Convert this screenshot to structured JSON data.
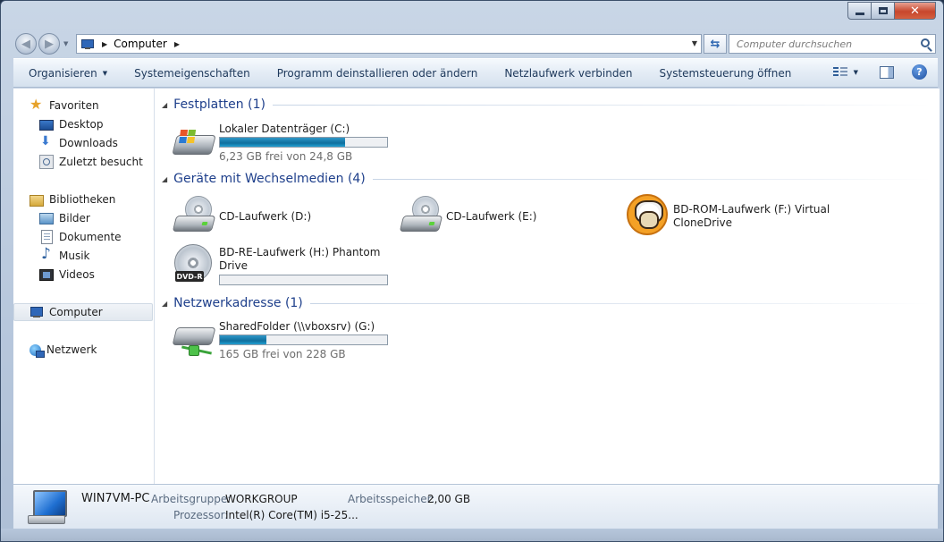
{
  "address": {
    "path": [
      "Computer"
    ],
    "search_placeholder": "Computer durchsuchen"
  },
  "toolbar": {
    "organize": "Organisieren",
    "items": [
      "Systemeigenschaften",
      "Programm deinstallieren oder ändern",
      "Netzlaufwerk verbinden",
      "Systemsteuerung öffnen"
    ],
    "help": "?"
  },
  "sidebar": {
    "favorites": "Favoriten",
    "favorites_items": [
      "Desktop",
      "Downloads",
      "Zuletzt besucht"
    ],
    "libraries": "Bibliotheken",
    "libraries_items": [
      "Bilder",
      "Dokumente",
      "Musik",
      "Videos"
    ],
    "computer": "Computer",
    "network": "Netzwerk"
  },
  "groups": [
    {
      "title": "Festplatten (1)"
    },
    {
      "title": "Geräte mit Wechselmedien (4)"
    },
    {
      "title": "Netzwerkadresse (1)"
    }
  ],
  "drives": {
    "c": {
      "name": "Lokaler Datenträger (C:)",
      "free": "6,23 GB frei von 24,8 GB",
      "used_fraction": 0.75
    },
    "d": {
      "name": "CD-Laufwerk (D:)"
    },
    "e": {
      "name": "CD-Laufwerk (E:)"
    },
    "f": {
      "name_line1": "BD-ROM-Laufwerk (F:) Virtual",
      "name_line2": "CloneDrive"
    },
    "h": {
      "name_line1": "BD-RE-Laufwerk (H:) Phantom",
      "name_line2": "Drive",
      "used_fraction": 0.0,
      "badge": "DVD-R"
    },
    "g": {
      "name": "SharedFolder (\\\\vboxsrv) (G:)",
      "free": "165 GB frei von 228 GB",
      "used_fraction": 0.28
    }
  },
  "details": {
    "pc_name": "WIN7VM-PC",
    "workgroup_label": "Arbeitsgruppe:",
    "workgroup": "WORKGROUP",
    "memory_label": "Arbeitsspeicher:",
    "memory": "2,00 GB",
    "cpu_label": "Prozessor:",
    "cpu": "Intel(R) Core(TM) i5-25..."
  },
  "colors": {
    "group_title": "#1e3f8b",
    "bar_fill": "#0f6f9d",
    "close_button": "#c7462c"
  }
}
